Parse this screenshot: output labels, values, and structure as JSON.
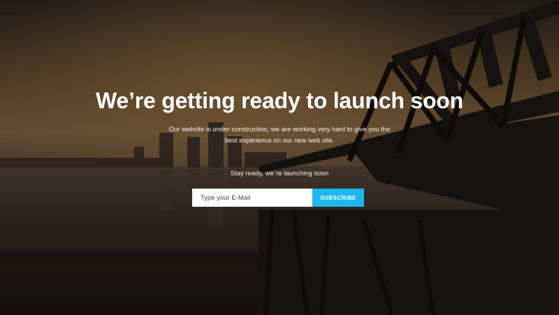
{
  "hero": {
    "headline": "We’re getting ready to launch soon",
    "subtext": "Our website is under construction, we are working very hard to give you the best experience on our new web site.",
    "stay_ready": "Stay ready, we`re launching soon"
  },
  "subscribe_form": {
    "email_placeholder": "Type your E-Mail",
    "button_label": "SUBSCRIBE"
  },
  "colors": {
    "accent": "#1cb8ec",
    "text": "#ffffff"
  }
}
